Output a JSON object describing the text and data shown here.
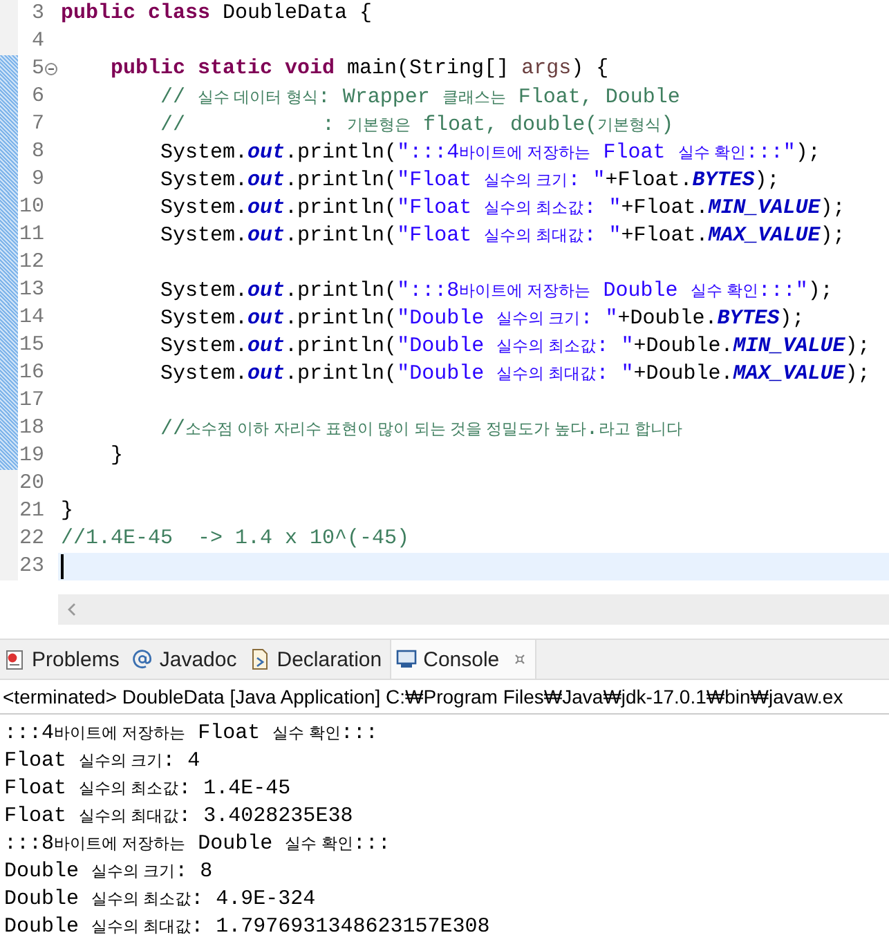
{
  "editor": {
    "lines": [
      {
        "number": "3",
        "changed": false,
        "current": false,
        "tokens": [
          {
            "t": "public class ",
            "kind": "keyword"
          },
          {
            "t": "DoubleData {",
            "kind": "plain"
          }
        ]
      },
      {
        "number": "4",
        "changed": false,
        "current": false
      },
      {
        "number": "5",
        "changed": true,
        "current": false,
        "folded": false,
        "tokens": [
          {
            "t": "    public static void ",
            "kind": "keyword"
          },
          {
            "t": "main(String[] ",
            "kind": "plain"
          },
          {
            "t": "args",
            "kind": "param"
          },
          {
            "t": ") {",
            "kind": "plain"
          }
        ]
      },
      {
        "number": "6",
        "changed": true,
        "current": false,
        "tokens": [
          {
            "t": "        // 실수 데이터 형식: Wrapper 클래스는 Float, Double",
            "kind": "comment"
          }
        ]
      },
      {
        "number": "7",
        "changed": true,
        "current": false,
        "tokens": [
          {
            "t": "        //           : 기본형은 float, double(기본형식)",
            "kind": "comment"
          }
        ]
      },
      {
        "number": "8",
        "changed": true,
        "current": false,
        "tokens": [
          {
            "t": "        System.",
            "kind": "plain"
          },
          {
            "t": "out",
            "kind": "field"
          },
          {
            "t": ".println(",
            "kind": "plain"
          },
          {
            "t": "\":::4바이트에 저장하는 Float 실수 확인:::\"",
            "kind": "string"
          },
          {
            "t": ");",
            "kind": "plain"
          }
        ]
      },
      {
        "number": "9",
        "changed": true,
        "current": false,
        "tokens": [
          {
            "t": "        System.",
            "kind": "plain"
          },
          {
            "t": "out",
            "kind": "field"
          },
          {
            "t": ".println(",
            "kind": "plain"
          },
          {
            "t": "\"Float 실수의 크기: \"",
            "kind": "string"
          },
          {
            "t": "+Float.",
            "kind": "plain"
          },
          {
            "t": "BYTES",
            "kind": "field"
          },
          {
            "t": ");",
            "kind": "plain"
          }
        ]
      },
      {
        "number": "10",
        "changed": true,
        "current": false,
        "tokens": [
          {
            "t": "        System.",
            "kind": "plain"
          },
          {
            "t": "out",
            "kind": "field"
          },
          {
            "t": ".println(",
            "kind": "plain"
          },
          {
            "t": "\"Float 실수의 최소값: \"",
            "kind": "string"
          },
          {
            "t": "+Float.",
            "kind": "plain"
          },
          {
            "t": "MIN_VALUE",
            "kind": "field"
          },
          {
            "t": ");",
            "kind": "plain"
          }
        ]
      },
      {
        "number": "11",
        "changed": true,
        "current": false,
        "tokens": [
          {
            "t": "        System.",
            "kind": "plain"
          },
          {
            "t": "out",
            "kind": "field"
          },
          {
            "t": ".println(",
            "kind": "plain"
          },
          {
            "t": "\"Float 실수의 최대값: \"",
            "kind": "string"
          },
          {
            "t": "+Float.",
            "kind": "plain"
          },
          {
            "t": "MAX_VALUE",
            "kind": "field"
          },
          {
            "t": ");",
            "kind": "plain"
          }
        ]
      },
      {
        "number": "12",
        "changed": true,
        "current": false
      },
      {
        "number": "13",
        "changed": true,
        "current": false,
        "tokens": [
          {
            "t": "        System.",
            "kind": "plain"
          },
          {
            "t": "out",
            "kind": "field"
          },
          {
            "t": ".println(",
            "kind": "plain"
          },
          {
            "t": "\":::8바이트에 저장하는 Double 실수 확인:::\"",
            "kind": "string"
          },
          {
            "t": ");",
            "kind": "plain"
          }
        ]
      },
      {
        "number": "14",
        "changed": true,
        "current": false,
        "tokens": [
          {
            "t": "        System.",
            "kind": "plain"
          },
          {
            "t": "out",
            "kind": "field"
          },
          {
            "t": ".println(",
            "kind": "plain"
          },
          {
            "t": "\"Double 실수의 크기: \"",
            "kind": "string"
          },
          {
            "t": "+Double.",
            "kind": "plain"
          },
          {
            "t": "BYTES",
            "kind": "field"
          },
          {
            "t": ");",
            "kind": "plain"
          }
        ]
      },
      {
        "number": "15",
        "changed": true,
        "current": false,
        "tokens": [
          {
            "t": "        System.",
            "kind": "plain"
          },
          {
            "t": "out",
            "kind": "field"
          },
          {
            "t": ".println(",
            "kind": "plain"
          },
          {
            "t": "\"Double 실수의 최소값: \"",
            "kind": "string"
          },
          {
            "t": "+Double.",
            "kind": "plain"
          },
          {
            "t": "MIN_VALUE",
            "kind": "field"
          },
          {
            "t": ");",
            "kind": "plain"
          }
        ]
      },
      {
        "number": "16",
        "changed": true,
        "current": false,
        "tokens": [
          {
            "t": "        System.",
            "kind": "plain"
          },
          {
            "t": "out",
            "kind": "field"
          },
          {
            "t": ".println(",
            "kind": "plain"
          },
          {
            "t": "\"Double 실수의 최대값: \"",
            "kind": "string"
          },
          {
            "t": "+Double.",
            "kind": "plain"
          },
          {
            "t": "MAX_VALUE",
            "kind": "field"
          },
          {
            "t": ");",
            "kind": "plain"
          }
        ]
      },
      {
        "number": "17",
        "changed": true,
        "current": false
      },
      {
        "number": "18",
        "changed": true,
        "current": false,
        "tokens": [
          {
            "t": "        //소수점 이하 자리수 표현이 많이 되는 것을 정밀도가 높다.라고 합니다",
            "kind": "comment"
          }
        ]
      },
      {
        "number": "19",
        "changed": true,
        "current": false,
        "tokens": [
          {
            "t": "    }",
            "kind": "plain"
          }
        ]
      },
      {
        "number": "20",
        "changed": false,
        "current": false
      },
      {
        "number": "21",
        "changed": false,
        "current": false,
        "tokens": [
          {
            "t": "}",
            "kind": "plain"
          }
        ]
      },
      {
        "number": "22",
        "changed": false,
        "current": false,
        "tokens": [
          {
            "t": "//1.4E-45  -> 1.4 x 10^(-45)",
            "kind": "comment"
          }
        ]
      },
      {
        "number": "23",
        "changed": false,
        "current": true
      }
    ]
  },
  "tabs": [
    {
      "label": "Problems",
      "selected": false,
      "closable": false
    },
    {
      "label": "Javadoc",
      "selected": false,
      "closable": false
    },
    {
      "label": "Declaration",
      "selected": false,
      "closable": false
    },
    {
      "label": "Console",
      "selected": true,
      "closable": true
    }
  ],
  "console": {
    "header": "<terminated> DoubleData [Java Application] C:₩Program Files₩Java₩jdk-17.0.1₩bin₩javaw.ex",
    "output": [
      ":::4바이트에 저장하는 Float 실수 확인:::",
      "Float 실수의 크기: 4",
      "Float 실수의 최소값: 1.4E-45",
      "Float 실수의 최대값: 3.4028235E38",
      ":::8바이트에 저장하는 Double 실수 확인:::",
      "Double 실수의 크기: 8",
      "Double 실수의 최소값: 4.9E-324",
      "Double 실수의 최대값: 1.7976931348623157E308"
    ]
  }
}
